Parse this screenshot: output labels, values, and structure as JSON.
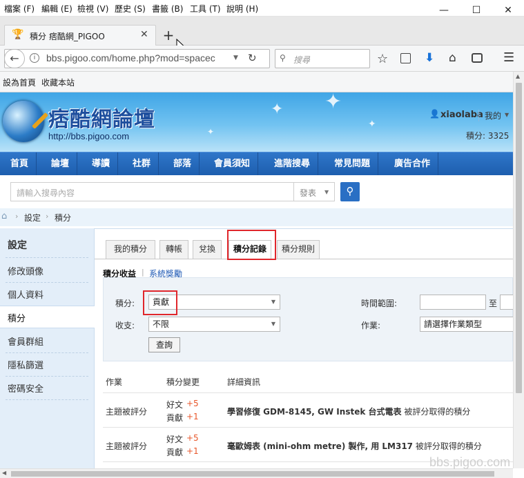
{
  "menubar": {
    "items": [
      "檔案 (F)",
      "編輯 (E)",
      "檢視 (V)",
      "歷史 (S)",
      "書籤 (B)",
      "工具 (T)",
      "說明 (H)"
    ]
  },
  "tabs": [
    {
      "title": "積分 痞酷網_PIGOO"
    }
  ],
  "navbar": {
    "url": "bbs.pigoo.com/home.php?mod=spacec",
    "search_placeholder": "搜尋"
  },
  "bookmarks": [
    "設為首頁",
    "收藏本站"
  ],
  "site": {
    "logo_text": "痞酷網論壇",
    "logo_url": "http://bbs.pigoo.com",
    "username": "xiaolaba",
    "my_menu": "我的",
    "points_label": "積分: 3325"
  },
  "sitenav": [
    "首頁",
    "論壇",
    "導讀",
    "社群",
    "部落",
    "會員須知",
    "進階搜尋",
    "常見問題",
    "廣告合作"
  ],
  "search": {
    "placeholder": "請輸入搜尋內容",
    "type_label": "發表"
  },
  "breadcrumb": [
    "設定",
    "積分"
  ],
  "sidebar": {
    "title": "設定",
    "items": [
      "修改頭像",
      "個人資料",
      "積分",
      "會員群組",
      "隱私篩選",
      "密碼安全"
    ]
  },
  "main_tabs": [
    "我的積分",
    "轉帳",
    "兌換",
    "積分記錄",
    "積分規則"
  ],
  "subtabs": [
    "積分收益",
    "系統獎勵"
  ],
  "filter": {
    "points_label": "積分:",
    "points_value": "貢獻",
    "inout_label": "收支:",
    "inout_value": "不限",
    "time_label": "時間範圍:",
    "to_label": "至",
    "op_label": "作業:",
    "op_value": "請選擇作業類型",
    "query_button": "查詢"
  },
  "table": {
    "headers": [
      "作業",
      "積分變更",
      "詳細資訊"
    ],
    "rows": [
      {
        "op": "主題被評分",
        "c1": "好文",
        "v1": "+5",
        "c2": "貢獻",
        "v2": "+1",
        "detail": "學習修復 GDM-8145, GW Instek 台式電表",
        "suffix": " 被評分取得的積分"
      },
      {
        "op": "主題被評分",
        "c1": "好文",
        "v1": "+5",
        "c2": "貢獻",
        "v2": "+1",
        "detail": "毫歐姆表 (mini-ohm metre) 製作, 用 LM317",
        "suffix": " 被評分取得的積分"
      }
    ]
  },
  "watermark": "bbs.pigoo.com",
  "colors": {
    "accent": "#1d5eae",
    "red_highlight": "#e0262b",
    "link": "#1a56b3",
    "positive": "#e8562a"
  }
}
